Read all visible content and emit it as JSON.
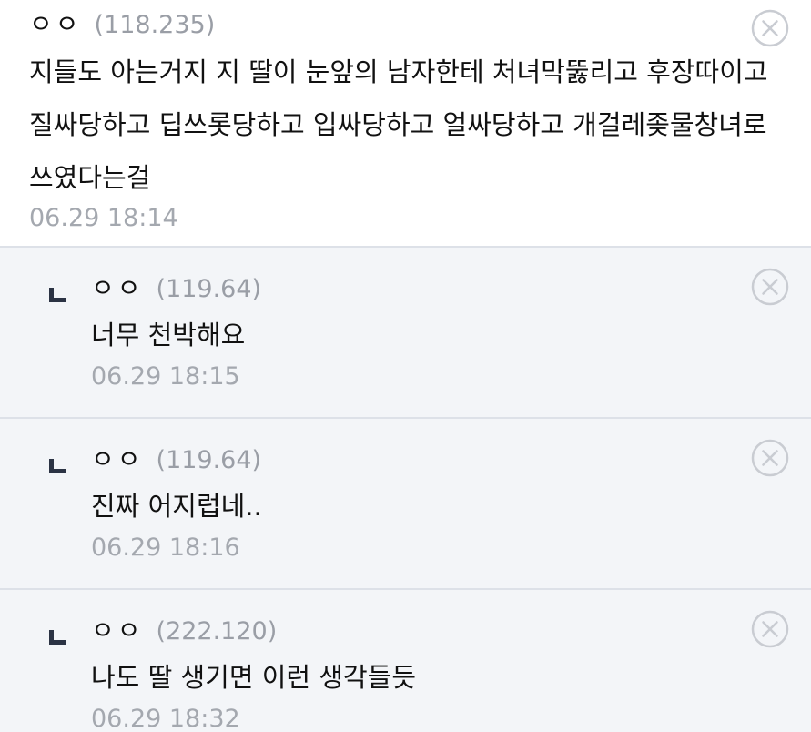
{
  "comments": [
    {
      "nickname": "ㅇㅇ",
      "ip": "(118.235)",
      "text": "지들도 아는거지 지 딸이 눈앞의 남자한테 처녀막뚫리고 후장따이고 질싸당하고 딥쓰롯당하고 입싸당하고 얼싸당하고 개걸레좆물창녀로 쓰였다는걸",
      "timestamp": "06.29 18:14"
    }
  ],
  "replies": [
    {
      "nickname": "ㅇㅇ",
      "ip": "(119.64)",
      "text": "너무 천박해요",
      "timestamp": "06.29 18:15"
    },
    {
      "nickname": "ㅇㅇ",
      "ip": "(119.64)",
      "text": "진짜 어지럽네..",
      "timestamp": "06.29 18:16"
    },
    {
      "nickname": "ㅇㅇ",
      "ip": "(222.120)",
      "text": "나도 딸 생기면 이런 생각들듯",
      "timestamp": "06.29 18:32"
    }
  ],
  "icons": {
    "delete": "close-circle-icon",
    "reply": "reply-arrow-icon"
  },
  "colors": {
    "reply_background": "#f3f5f8",
    "divider": "#dde1e8",
    "muted_text": "#9a9ea6",
    "delete_icon": "#c9ccd2"
  }
}
